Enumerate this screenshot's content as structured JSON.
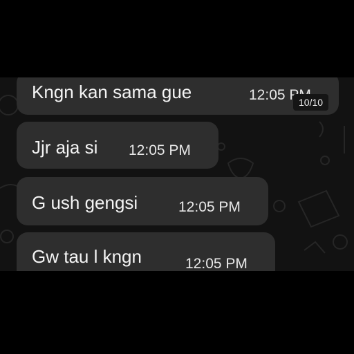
{
  "messages": [
    {
      "text": "Kngn kan sama gue",
      "time": "12:05 PM"
    },
    {
      "text": "Jjr aja si",
      "time": "12:05 PM"
    },
    {
      "text": "G ush gengsi",
      "time": "12:05 PM"
    },
    {
      "text": "Gw tau l kngn",
      "time": "12:05 PM"
    }
  ],
  "page_counter": "10/10",
  "colors": {
    "frame": "#000000",
    "chat_background": "#121212",
    "bubble": "#2e2e2e",
    "text": "#f4f4f4"
  },
  "icons": [
    "chat-wallpaper-doodle-icons"
  ]
}
